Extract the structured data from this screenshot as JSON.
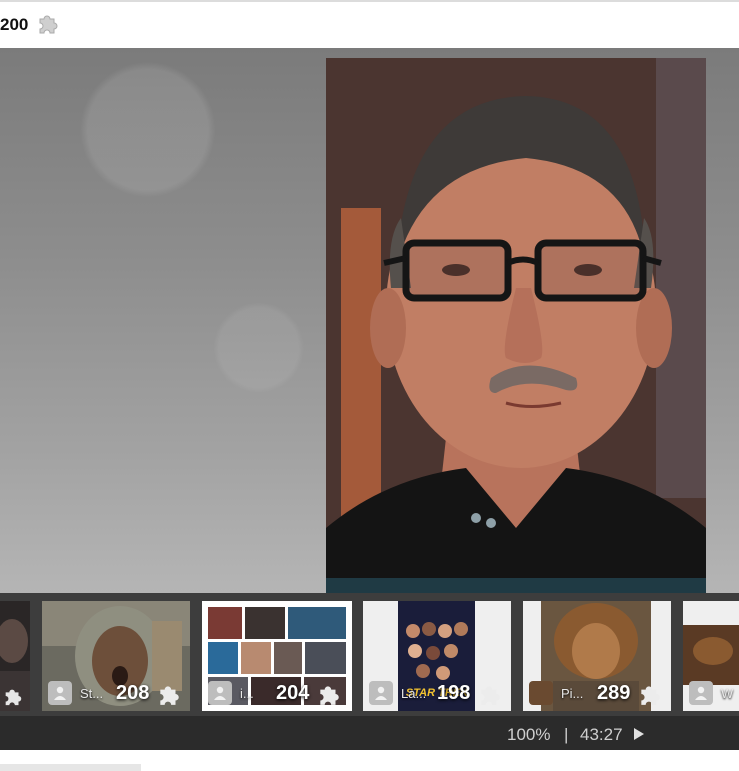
{
  "header": {
    "piece_count": "200",
    "piece_icon": "puzzle-piece-icon"
  },
  "main_image": {
    "alt_subject": "portrait"
  },
  "thumbnails": [
    {
      "user": "",
      "count": "",
      "icon": "puzzle-piece-icon"
    },
    {
      "user": "St...",
      "count": "208",
      "icon": "puzzle-piece-icon"
    },
    {
      "user": "i...",
      "count": "204",
      "icon": "puzzle-piece-icon"
    },
    {
      "user": "La...",
      "count": "198",
      "icon": "puzzle-piece-icon"
    },
    {
      "user": "Pi...",
      "count": "289",
      "icon": "puzzle-piece-icon"
    },
    {
      "user": "W",
      "count": "",
      "icon": ""
    }
  ],
  "thumb3_poster": {
    "line1": "STAR TREK"
  },
  "status": {
    "zoom": "100%",
    "separator": "|",
    "time": "43:27"
  },
  "colors": {
    "strip_bg": "#3d3d3d",
    "status_bg": "#2b2b2b",
    "stage_bg": "#8e8e8e"
  }
}
